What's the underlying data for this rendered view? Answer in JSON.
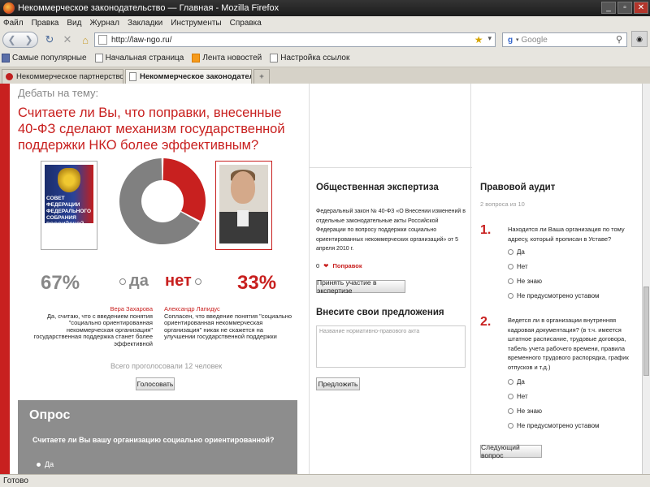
{
  "window": {
    "title": "Некоммерческое законодательство — Главная - Mozilla Firefox"
  },
  "menu": {
    "items": [
      "Файл",
      "Правка",
      "Вид",
      "Журнал",
      "Закладки",
      "Инструменты",
      "Справка"
    ]
  },
  "nav": {
    "url": "http://law-ngo.ru/",
    "search_placeholder": "Google"
  },
  "bookmarks": [
    "Самые популярные",
    "Начальная страница",
    "Лента новостей",
    "Настройка ссылок"
  ],
  "tabs": [
    {
      "label": "Некоммерческое партнерство «Юрис...»"
    },
    {
      "label": "Некоммерческое законодатель..."
    }
  ],
  "debate": {
    "title": "Дебаты на тему:",
    "question": "Считаете ли Вы, что поправки, внесенные 40-ФЗ сделают механизм государственной поддержки НКО более эффективным?",
    "yes_pct": "67%",
    "yes_label": "да",
    "no_label": "нет",
    "no_pct": "33%",
    "left_name": "Вера Захарова",
    "left_text": "Да, считаю, что с введением понятия \"социально ориентированная некоммерческая организация\" государственная поддержка станет более эффективной",
    "right_name": "Александр Лапидус",
    "right_text": "Сопласен, что введение понятия \"социально ориентированная некоммерческая организация\" никак не скажется на улучшении государственной поддержки",
    "total": "Всего проголосовали 12 человек",
    "vote_button": "Голосовать",
    "flag_text": "СОВЕТ ФЕДЕРАЦИИ ФЕДЕРАЛЬНОГО СОБРАНИЯ РОССИЙСКОЙ ФЕДЕРАЦИИ"
  },
  "chart_data": {
    "type": "pie",
    "categories": [
      "да",
      "нет"
    ],
    "values": [
      67,
      33
    ],
    "colors": [
      "#808080",
      "#c8201f"
    ]
  },
  "poll": {
    "title": "Опрос",
    "question": "Считаете ли Вы вашу организацию социально ориентированной?",
    "first_answer": "Да"
  },
  "expertise": {
    "title": "Общественная экспертиза",
    "text": "Федеральный закон № 40-ФЗ «О Внесении изменений в отдельные законодательные акты Российской Федерации по вопросу поддержки социально ориентированных некоммерческих организаций» от 5 апреля 2010 г.",
    "count": "0",
    "count_label": "Поправок",
    "join_button": "Принять участие в экспертизе"
  },
  "suggest": {
    "title": "Внесите свои предложения",
    "placeholder": "Название нормативно-правового акта",
    "button": "Предложить"
  },
  "audit": {
    "title": "Правовой аудит",
    "subtitle": "2 вопроса из 10",
    "q1_num": "1.",
    "q1_text": "Находится ли Ваша организация по тому адресу, который прописан в Уставе?",
    "q1_options": [
      "Да",
      "Нет",
      "Не знаю",
      "Не предусмотрено уставом"
    ],
    "q2_num": "2.",
    "q2_text": "Ведется ли в организации внутренняя кадровая документация? (в т.ч. имеется штатное расписание, трудовые договора, табель учета рабочего времени, правила временного трудового распорядка, график отпусков и т.д.)",
    "q2_options": [
      "Да",
      "Нет",
      "Не знаю",
      "Не предусмотрено уставом"
    ],
    "next_button": "Следующий вопрос"
  },
  "status": {
    "text": "Готово"
  }
}
